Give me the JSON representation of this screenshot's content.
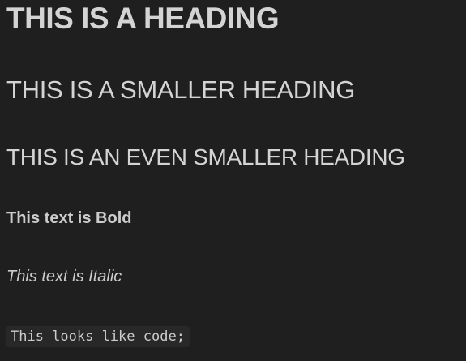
{
  "document": {
    "heading1": "THIS IS A HEADING",
    "heading2": "THIS IS A SMALLER HEADING",
    "heading3": "THIS IS AN EVEN SMALLER HEADING",
    "bold_text": "This text is Bold",
    "italic_text": "This text is Italic",
    "code_text": "This looks like code;"
  },
  "colors": {
    "background": "#1f1f1f",
    "text": "#cccccc",
    "code_background": "#282828"
  }
}
